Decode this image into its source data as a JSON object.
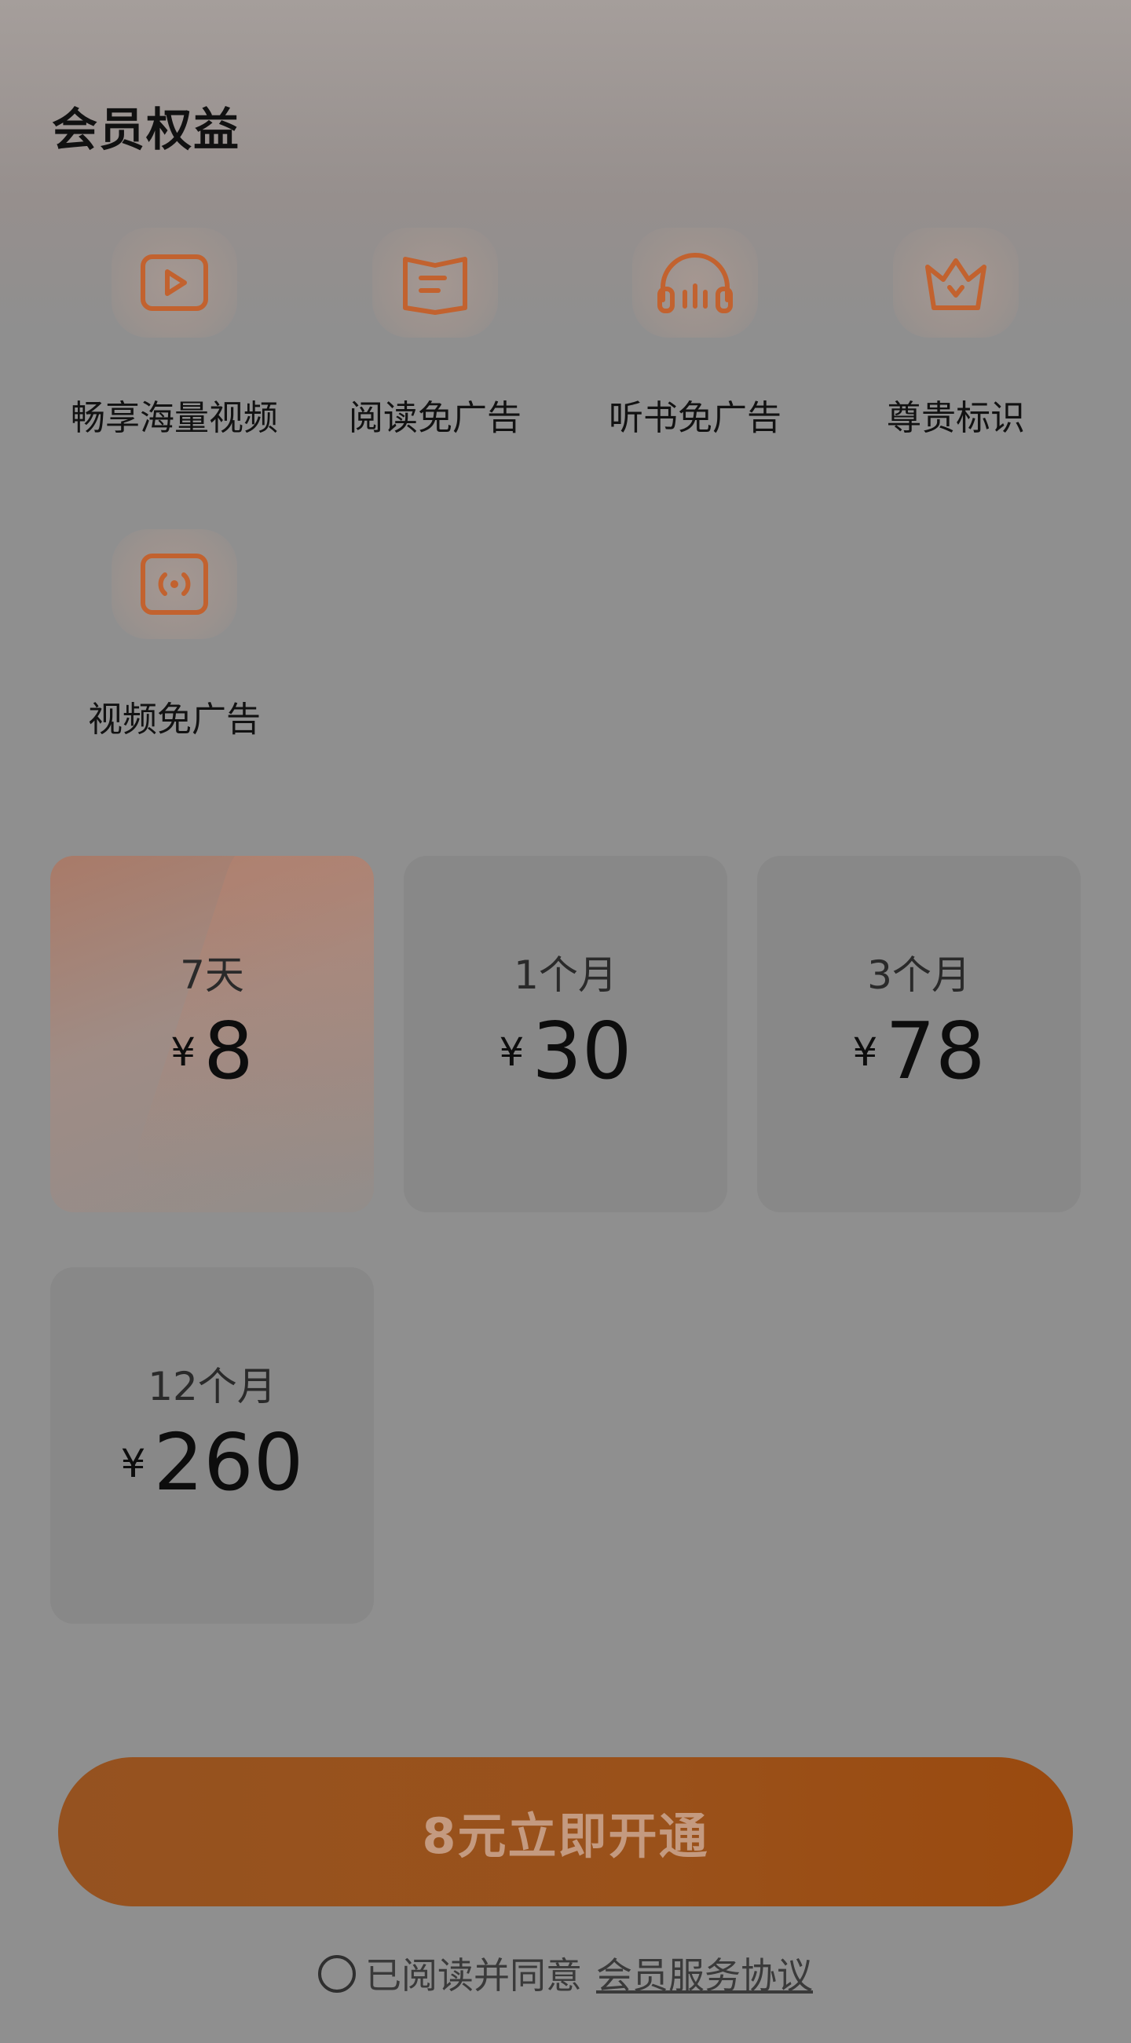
{
  "header": {
    "title": "会员权益"
  },
  "benefits": [
    {
      "label": "畅享海量视频",
      "icon": "play-icon"
    },
    {
      "label": "阅读免广告",
      "icon": "book-icon"
    },
    {
      "label": "听书免广告",
      "icon": "headphones-icon"
    },
    {
      "label": "尊贵标识",
      "icon": "crown-icon"
    },
    {
      "label": "视频免广告",
      "icon": "broadcast-icon"
    }
  ],
  "plans": [
    {
      "duration": "7天",
      "currency": "¥",
      "price": "8",
      "selected": true
    },
    {
      "duration": "1个月",
      "currency": "¥",
      "price": "30",
      "selected": false
    },
    {
      "duration": "3个月",
      "currency": "¥",
      "price": "78",
      "selected": false
    },
    {
      "duration": "12个月",
      "currency": "¥",
      "price": "260",
      "selected": false
    }
  ],
  "cta": {
    "label": "8元立即开通"
  },
  "agreement": {
    "text": "已阅读并同意",
    "link": "会员服务协议"
  },
  "colors": {
    "accent": "#e0701e",
    "icon_orange": "#c2622f"
  }
}
